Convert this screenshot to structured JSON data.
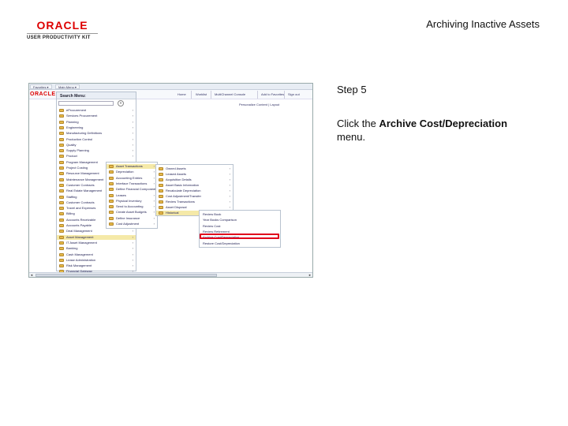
{
  "logo": {
    "brand": "ORACLE",
    "subtitle": "USER PRODUCTIVITY KIT"
  },
  "slide_title": "Archiving Inactive Assets",
  "step_label": "Step 5",
  "instruction": {
    "prefix": "Click the ",
    "bold": "Archive Cost/Depreciation",
    "suffix": " menu."
  },
  "screenshot": {
    "browser_tabs": [
      "Favorites ▾",
      "Main Menu ▾"
    ],
    "header_brand": "ORACLE",
    "header_links": [
      "Home",
      "Worklist",
      "MultiChannel Console",
      "Add to Favorites",
      "Sign out"
    ],
    "personalize_text": "Personalize Content | Layout",
    "search_menu_title": "Search Menu:",
    "search_button": "»",
    "main_menu": [
      {
        "label": "eProcurement",
        "submenu": true
      },
      {
        "label": "Services Procurement",
        "submenu": true
      },
      {
        "label": "Planning",
        "submenu": true
      },
      {
        "label": "Engineering",
        "submenu": true
      },
      {
        "label": "Manufacturing Definitions",
        "submenu": true
      },
      {
        "label": "Production Control",
        "submenu": true
      },
      {
        "label": "Quality",
        "submenu": true
      },
      {
        "label": "Supply Planning",
        "submenu": true
      },
      {
        "label": "Product",
        "submenu": true
      },
      {
        "label": "Program Management",
        "submenu": true
      },
      {
        "label": "Project Costing",
        "submenu": true
      },
      {
        "label": "Resource Management",
        "submenu": true
      },
      {
        "label": "Maintenance Management",
        "submenu": true
      },
      {
        "label": "Customer Contracts",
        "submenu": true
      },
      {
        "label": "Real Estate Management",
        "submenu": true
      },
      {
        "label": "Staffing",
        "submenu": true
      },
      {
        "label": "Customer Contracts",
        "submenu": true
      },
      {
        "label": "Travel and Expenses",
        "submenu": true
      },
      {
        "label": "Billing",
        "submenu": true
      },
      {
        "label": "Accounts Receivable",
        "submenu": true
      },
      {
        "label": "Accounts Payable",
        "submenu": true
      },
      {
        "label": "Deal Management",
        "submenu": true
      },
      {
        "label": "Asset Management",
        "submenu": true,
        "highlight": true
      },
      {
        "label": "IT Asset Management",
        "submenu": true
      },
      {
        "label": "Banking",
        "submenu": true
      },
      {
        "label": "Cash Management",
        "submenu": true
      },
      {
        "label": "Lease Administration",
        "submenu": true
      },
      {
        "label": "Risk Management",
        "submenu": true
      },
      {
        "label": "Financial Gateway",
        "submenu": true
      }
    ],
    "asset_menu": [
      {
        "label": "Asset Transactions",
        "submenu": true,
        "highlight": true
      },
      {
        "label": "Depreciation",
        "submenu": true
      },
      {
        "label": "Accounting Entries",
        "submenu": true
      },
      {
        "label": "Interface Transactions",
        "submenu": true
      },
      {
        "label": "Define Financial Components",
        "submenu": true
      },
      {
        "label": "Leases",
        "submenu": true
      },
      {
        "label": "Physical Inventory",
        "submenu": true
      },
      {
        "label": "Send to Accounting",
        "submenu": true
      },
      {
        "label": "Create Asset Budgets",
        "submenu": true
      },
      {
        "label": "Define Insurance",
        "submenu": true
      },
      {
        "label": "Cost Adjustment",
        "submenu": true
      }
    ],
    "transactions_menu": [
      {
        "label": "Owned Assets",
        "submenu": true
      },
      {
        "label": "Leased Assets",
        "submenu": true
      },
      {
        "label": "Acquisition Details",
        "submenu": true
      },
      {
        "label": "Asset Basic Information",
        "submenu": true
      },
      {
        "label": "Recalculate Depreciation",
        "submenu": true
      },
      {
        "label": "Cost Adjustment/Transfer",
        "submenu": true
      },
      {
        "label": "Review Transactions",
        "submenu": true
      },
      {
        "label": "Asset Disposal",
        "submenu": true
      },
      {
        "label": "Historical",
        "submenu": true,
        "highlight": true
      }
    ],
    "history_menu": [
      {
        "label": "Review Book"
      },
      {
        "label": "Year Books Comparison"
      },
      {
        "label": "Review Cost"
      },
      {
        "label": "Review Retirement"
      },
      {
        "label": "Archive Cost/Depreciation",
        "target": true
      },
      {
        "label": "Restore Cost/Depreciation"
      }
    ],
    "scroll_left": "◄",
    "scroll_right": "►"
  }
}
